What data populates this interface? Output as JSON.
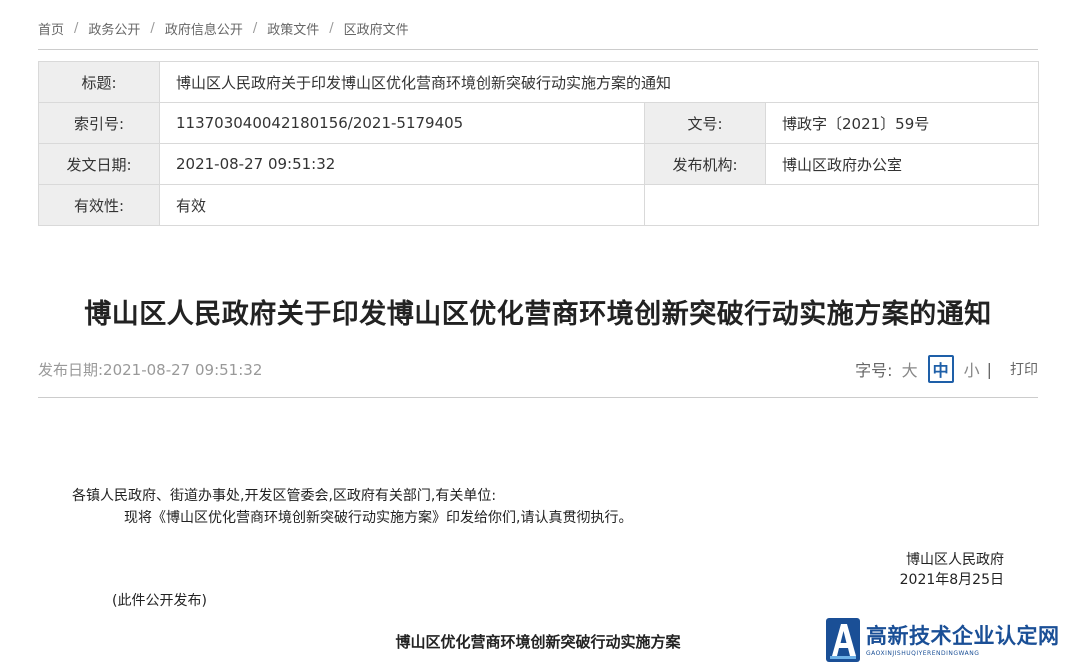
{
  "breadcrumb": [
    "首页",
    "政务公开",
    "政府信息公开",
    "政策文件",
    "区政府文件"
  ],
  "breadcrumb_separator": "/",
  "meta": {
    "title_label": "标题:",
    "title_value": "博山区人民政府关于印发博山区优化营商环境创新突破行动实施方案的通知",
    "index_label": "索引号:",
    "index_value": "113703040042180156/2021-5179405",
    "docno_label": "文号:",
    "docno_value": "博政字〔2021〕59号",
    "date_label": "发文日期:",
    "date_value": "2021-08-27 09:51:32",
    "org_label": "发布机构:",
    "org_value": "博山区政府办公室",
    "validity_label": "有效性:",
    "validity_value": "有效"
  },
  "article": {
    "title": "博山区人民政府关于印发博山区优化营商环境创新突破行动实施方案的通知",
    "publish_date": "发布日期:2021-08-27 09:51:32",
    "font_size_label": "字号:",
    "font_large": "大",
    "font_medium": "中",
    "font_small": "小",
    "font_separator": "|",
    "print_label": "打印",
    "addressee": "各镇人民政府、街道办事处,开发区管委会,区政府有关部门,有关单位:",
    "paragraph": "现将《博山区优化营商环境创新突破行动实施方案》印发给你们,请认真贯彻执行。",
    "signature_org": "博山区人民政府",
    "signature_date": "2021年8月25日",
    "public_note": "(此件公开发布)",
    "plan_title": "博山区优化营商环境创新突破行动实施方案"
  },
  "watermark": {
    "text": "高新技术企业认定网",
    "subtext": "GAOXINJISHUQIYERENDINGWANG"
  },
  "colors": {
    "accent": "#1e5fa8",
    "table_header_bg": "#eeeeee",
    "border": "#d9d9d9",
    "watermark": "#1a4f96"
  }
}
